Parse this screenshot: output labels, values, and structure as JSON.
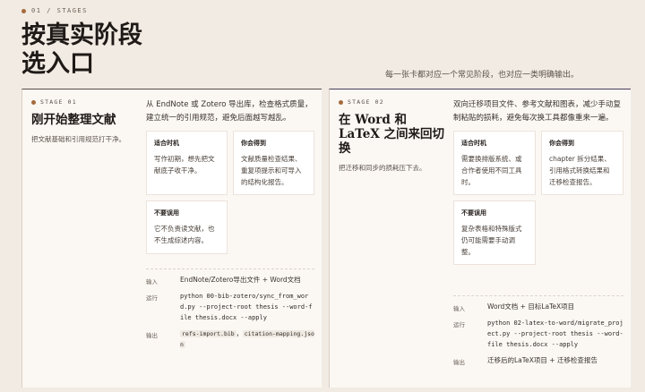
{
  "header": {
    "eyebrow": "01 / STAGES",
    "title": "按真实阶段选入口",
    "subtitle": "每一张卡都对应一个常见阶段，也对应一类明确输出。"
  },
  "cards": [
    {
      "stage_label": "STAGE 01",
      "title": "刚开始整理文献",
      "subtitle": "把文献基础和引用规范打干净。",
      "description": "从 EndNote 或 Zotero 导出库，检查格式质量，建立统一的引用规范，避免后面越写越乱。",
      "tiles": [
        {
          "title": "适合时机",
          "body": "写作初期，想先把文献底子收干净。"
        },
        {
          "title": "你会得到",
          "body": "文献质量检查结果、重复项提示和可导入的结构化报告。"
        },
        {
          "title": "不要误用",
          "body": "它不负责读文献，也不生成综述内容。"
        }
      ],
      "io": {
        "input_key": "输入",
        "input_val": "EndNote/Zotero导出文件 + Word文档",
        "run_key": "运行",
        "run_val": "python 00-bib-zotero/sync_from_word.py --project-root thesis --word-file thesis.docx --apply",
        "output_key": "输出",
        "output_val_1": "refs-import.bib",
        "output_sep": "，",
        "output_val_2": "citation-mapping.json"
      }
    },
    {
      "stage_label": "STAGE 02",
      "title": "在 Word 和 LaTeX 之间来回切换",
      "subtitle": "把迁移和同步的损耗压下去。",
      "description": "双向迁移项目文件、参考文献和图表，减少手动复制粘贴的损耗，避免每次换工具都像重来一遍。",
      "tiles": [
        {
          "title": "适合时机",
          "body": "需要换排版系统、或合作者使用不同工具时。"
        },
        {
          "title": "你会得到",
          "body": "chapter 拆分结果、引用格式转换结果和迁移检查报告。"
        },
        {
          "title": "不要误用",
          "body": "复杂表格和特殊版式仍可能需要手动调整。"
        }
      ],
      "io": {
        "input_key": "输入",
        "input_val": "Word文档 + 目标LaTeX项目",
        "run_key": "运行",
        "run_val": "python 02-latex-to-word/migrate_project.py --project-root thesis --word-file thesis.docx --apply",
        "output_key": "输出",
        "output_val": "迁移后的LaTeX项目 + 迁移检查报告"
      }
    }
  ],
  "colors": {
    "background": "#f1ebe3",
    "accent_dot": "#a66a3c",
    "card": "#fbf8f4"
  }
}
